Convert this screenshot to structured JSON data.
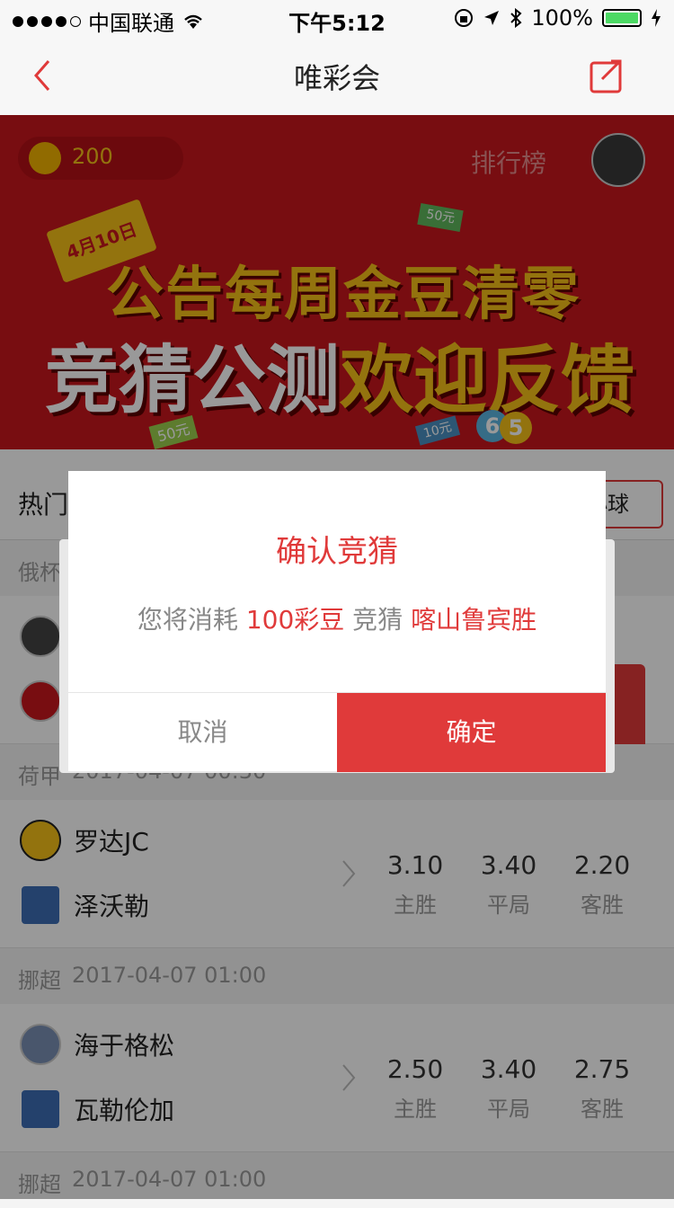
{
  "status_bar": {
    "carrier": "中国联通",
    "time": "下午5:12",
    "battery": "100%"
  },
  "nav": {
    "title": "唯彩会"
  },
  "banner": {
    "coin_count": "200",
    "rank_label": "排行榜",
    "flag_text": "4月10日",
    "line1": "公告每周金豆清零",
    "line2_a": "竞猜公测",
    "line2_b": "欢迎反馈",
    "tag_50": "50元",
    "tag_50b": "50元",
    "tag_10": "10元",
    "ball_6": "6",
    "ball_5": "5"
  },
  "filter": {
    "label": "热门",
    "pill": "小球"
  },
  "groups": [
    {
      "league": "俄杯",
      "date": ""
    },
    {
      "league": "荷甲",
      "date": "2017-04-07 00:30"
    },
    {
      "league": "挪超",
      "date": "2017-04-07 01:00"
    },
    {
      "league": "挪超",
      "date": "2017-04-07 01:00"
    }
  ],
  "matches": [
    {
      "home": "罗达JC",
      "away": "泽沃勒",
      "odds": [
        "3.10",
        "3.40",
        "2.20"
      ],
      "labels": [
        "主胜",
        "平局",
        "客胜"
      ]
    },
    {
      "home": "海于格松",
      "away": "瓦勒伦加",
      "odds": [
        "2.50",
        "3.40",
        "2.75"
      ],
      "labels": [
        "主胜",
        "平局",
        "客胜"
      ]
    }
  ],
  "dialog": {
    "title": "确认竞猜",
    "msg_prefix": "您将消耗",
    "msg_amount": "100彩豆",
    "msg_middle": "竞猜",
    "msg_pick": "喀山鲁宾胜",
    "cancel": "取消",
    "confirm": "确定"
  },
  "colors": {
    "accent": "#e03a3a",
    "banner_red": "#c8161d",
    "gold": "#f5c018"
  }
}
